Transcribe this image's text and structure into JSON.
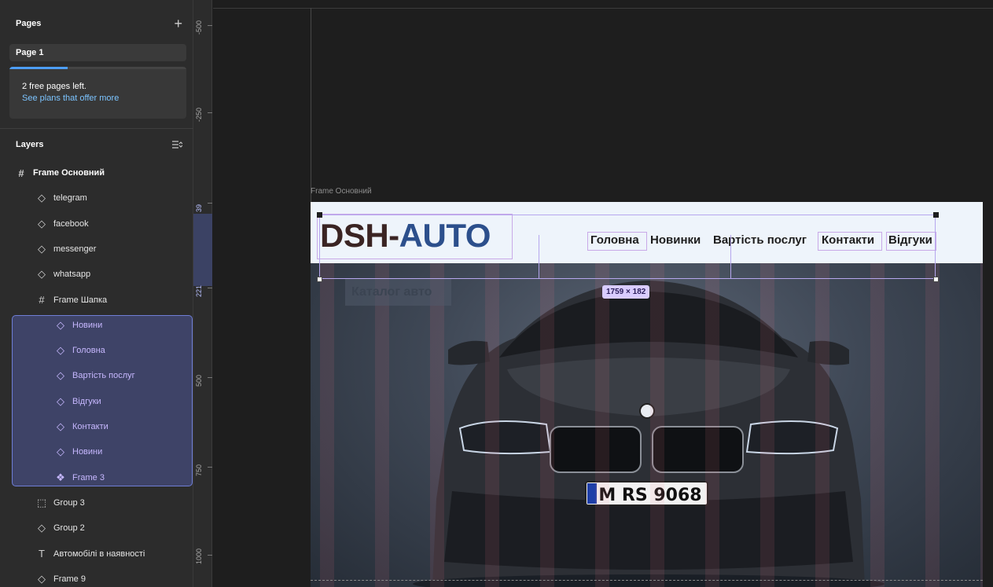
{
  "pages": {
    "title": "Pages",
    "add_icon": "+",
    "current_page": "Page 1",
    "notice_text": "2 free pages left.",
    "notice_link": "See plans that offer more",
    "progress_fraction": 0.33
  },
  "layers": {
    "title": "Layers",
    "items": [
      {
        "label": "Frame Основний",
        "icon": "#",
        "level": 0,
        "bold": true
      },
      {
        "label": "telegram",
        "icon": "◇",
        "level": 1
      },
      {
        "label": "facebook",
        "icon": "◇",
        "level": 1
      },
      {
        "label": "messenger",
        "icon": "◇",
        "level": 1
      },
      {
        "label": "whatsapp",
        "icon": "◇",
        "level": 1
      },
      {
        "label": "Frame Шапка",
        "icon": "#",
        "level": 1
      },
      {
        "label": "Новини",
        "icon": "◇",
        "level": 2,
        "selected": true
      },
      {
        "label": "Головна",
        "icon": "◇",
        "level": 2,
        "selected": true
      },
      {
        "label": "Вартість послуг",
        "icon": "◇",
        "level": 2,
        "selected": true
      },
      {
        "label": "Відгуки",
        "icon": "◇",
        "level": 2,
        "selected": true
      },
      {
        "label": "Контакти",
        "icon": "◇",
        "level": 2,
        "selected": true
      },
      {
        "label": "Новини",
        "icon": "◇",
        "level": 2,
        "selected": true
      },
      {
        "label": "Frame 3",
        "icon": "❖",
        "level": 2,
        "selected": true
      },
      {
        "label": "Group 3",
        "icon": "⬚",
        "level": 1
      },
      {
        "label": "Group 2",
        "icon": "◇",
        "level": 1
      },
      {
        "label": "Автомобілі в наявності",
        "icon": "T",
        "level": 1
      },
      {
        "label": "Frame 9",
        "icon": "◇",
        "level": 1
      }
    ]
  },
  "ruler": {
    "labels": [
      "-500",
      "-250",
      "39",
      "221",
      "500",
      "750",
      "1000"
    ]
  },
  "canvas": {
    "frame_label": "Frame Основний",
    "logo_part1": "DSH-",
    "logo_part2": "AUTO",
    "nav": [
      "Головна",
      "Новинки",
      "Вартість послуг",
      "Контакти",
      "Відгуки"
    ],
    "catalog": "Каталог авто",
    "selection_size": "1759 × 182",
    "plate": "M RS 9068",
    "accent_color": "#2c4f8c",
    "selection_color": "#b6a7ee"
  }
}
